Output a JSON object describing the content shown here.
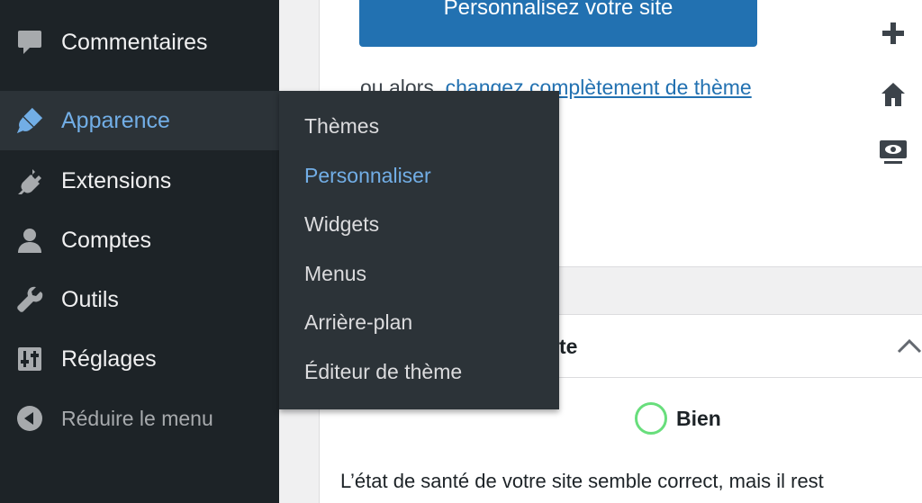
{
  "sidebar": {
    "items": [
      {
        "label": "Commentaires",
        "icon": "comment-icon"
      },
      {
        "label": "Apparence",
        "icon": "paintbrush-icon"
      },
      {
        "label": "Extensions",
        "icon": "plugin-icon"
      },
      {
        "label": "Comptes",
        "icon": "user-icon"
      },
      {
        "label": "Outils",
        "icon": "wrench-icon"
      },
      {
        "label": "Réglages",
        "icon": "settings-sliders-icon"
      }
    ],
    "collapse_label": "Réduire le menu"
  },
  "submenu": {
    "items": [
      "Thèmes",
      "Personnaliser",
      "Widgets",
      "Menus",
      "Arrière-plan",
      "Éditeur de thème"
    ],
    "current": "Personnaliser"
  },
  "welcome": {
    "button_label": "Personnalisez votre site",
    "alt_prefix": "ou alors, ",
    "alt_link": "changez complètement de thème"
  },
  "health": {
    "title_visible": "te",
    "status": "Bien",
    "description": "L’état de santé de votre site semble correct, mais il rest"
  },
  "colors": {
    "sidebar_bg": "#1d2327",
    "submenu_bg": "#2c3338",
    "accent": "#72aee6",
    "button_bg": "#2271b1",
    "status_good": "#68de7c"
  }
}
